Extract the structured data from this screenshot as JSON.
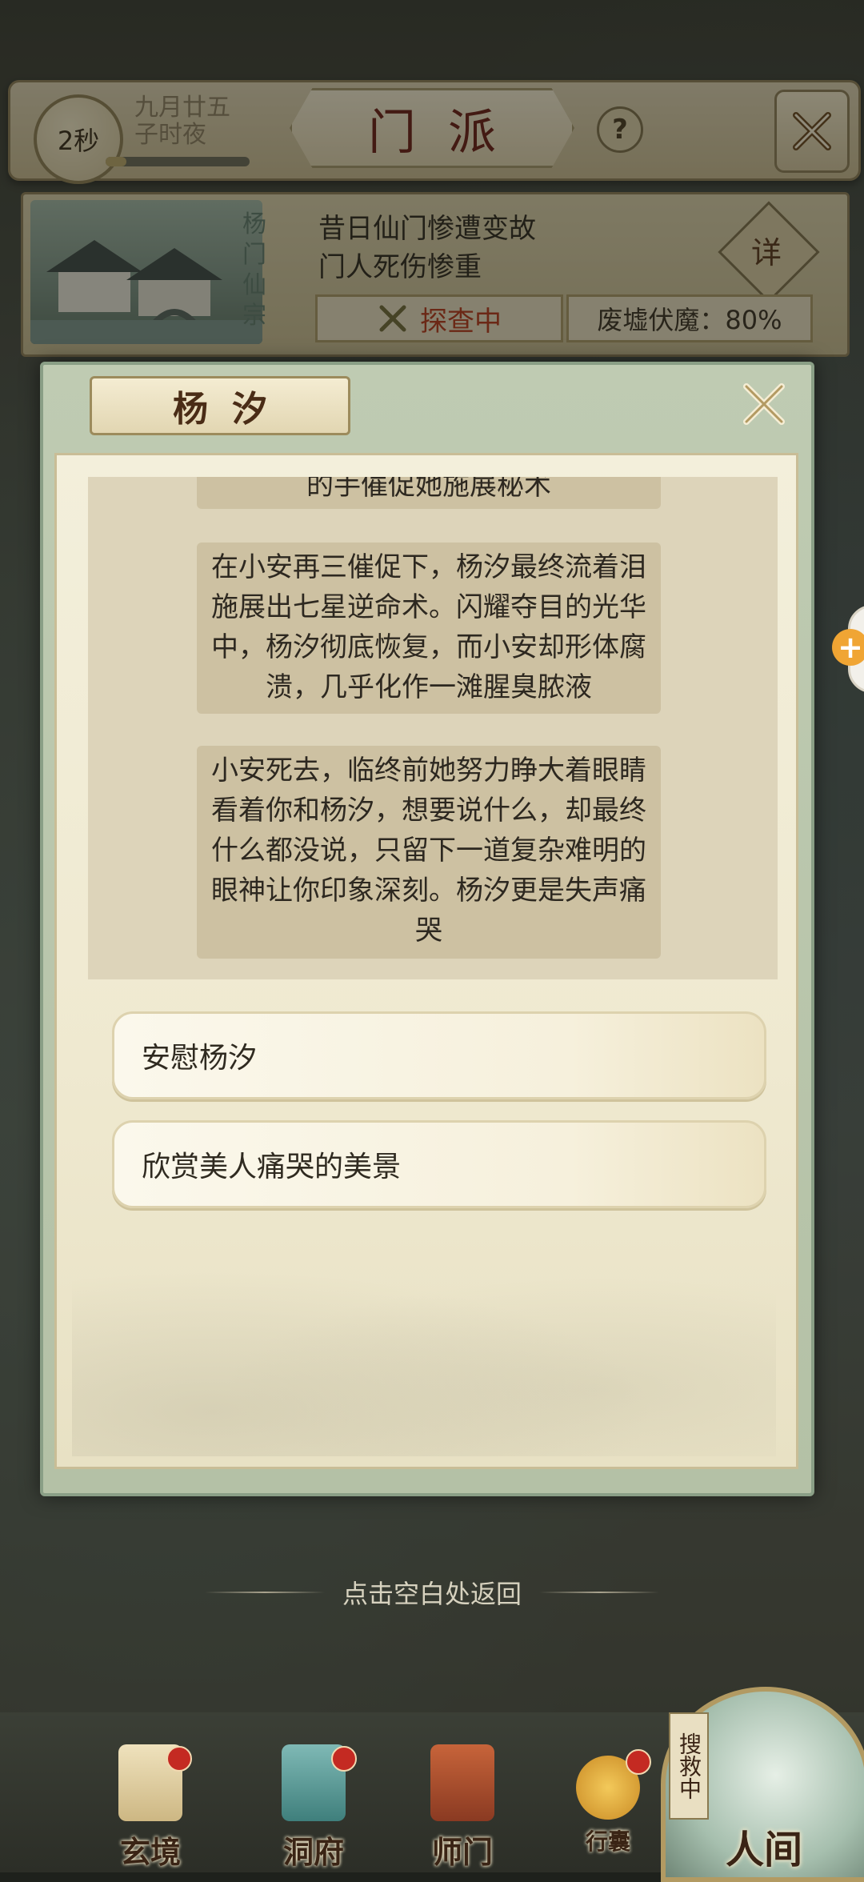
{
  "header": {
    "timer": "2秒",
    "date_line1": "九月廿五",
    "date_line2": "子时夜",
    "title": "门派",
    "help_icon": "question-mark-icon",
    "close_icon": "crossed-swords-close-icon"
  },
  "event": {
    "sect_name": "杨门仙宗",
    "text_line1": "昔日仙门惨遭变故",
    "text_line2": "门人死伤惨重",
    "detail_label": "详",
    "status_label": "探查中",
    "progress_label": "废墟伏魔：80%",
    "progress_value": 0.8
  },
  "dialog": {
    "title": "杨汐",
    "story": [
      "的手催促她施展秘术",
      "在小安再三催促下，杨汐最终流着泪施展出七星逆命术。闪耀夺目的光华中，杨汐彻底恢复，而小安却形体腐溃，几乎化作一滩腥臭脓液",
      "小安死去，临终前她努力睁大着眼睛看着你和杨汐，想要说什么，却最终什么都没说，只留下一道复杂难明的眼神让你印象深刻。杨汐更是失声痛哭"
    ],
    "choices": [
      "安慰杨汐",
      "欣赏美人痛哭的美景"
    ]
  },
  "return_hint": "点击空白处返回",
  "nav": [
    {
      "label": "玄境",
      "icon": "scroll-icon",
      "badge": true
    },
    {
      "label": "洞府",
      "icon": "pavilion-icon",
      "badge": true
    },
    {
      "label": "师门",
      "icon": "banner-icon",
      "badge": false
    },
    {
      "label": "行囊",
      "icon": "pouch-icon",
      "badge": true
    }
  ],
  "world": {
    "label": "人间",
    "search_tag": "搜救中"
  },
  "colors": {
    "status_red": "#b33a1c",
    "title_red": "#6a1f16",
    "badge_red": "#c42a22"
  }
}
